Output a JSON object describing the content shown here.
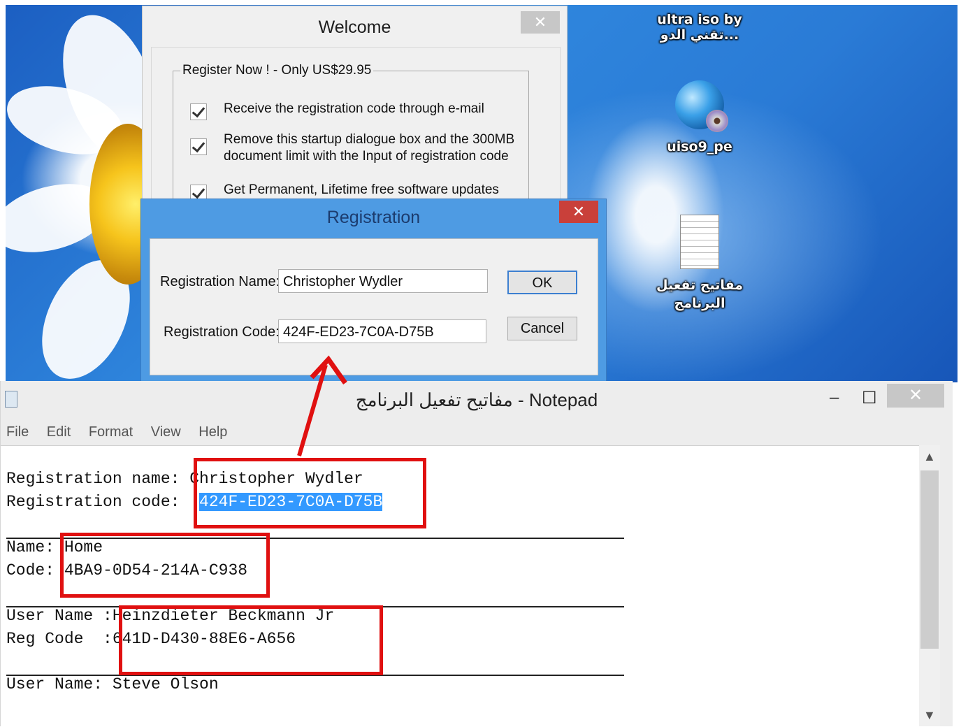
{
  "desktop": {
    "icons": [
      {
        "label": "ultra iso by تقني الدو...",
        "icon": "ultraiso-app-icon"
      },
      {
        "label": "uiso9_pe",
        "icon": "globe-disc-icon"
      },
      {
        "label": "مفاتيح تفعيل البرنامج",
        "icon": "text-file-icon"
      }
    ]
  },
  "welcome": {
    "title": "Welcome",
    "close": "✕",
    "group_label": "Register Now ! - Only US$29.95",
    "items": [
      "Receive the registration code through e-mail",
      "Remove this startup dialogue box and the 300MB document limit with the Input of registration code",
      "Get Permanent, Lifetime free software updates"
    ]
  },
  "registration": {
    "title": "Registration",
    "close": "✕",
    "name_label": "Registration Name:",
    "name_value": "Christopher Wydler",
    "code_label": "Registration Code:",
    "code_value": "424F-ED23-7C0A-D75B",
    "ok": "OK",
    "cancel": "Cancel"
  },
  "notepad": {
    "title": "مفاتيح تفعيل البرنامج - Notepad",
    "minimize": "–",
    "maximize": "☐",
    "close": "✕",
    "menu": [
      "File",
      "Edit",
      "Format",
      "View",
      "Help"
    ],
    "entries": {
      "reg_name_label": "Registration name: ",
      "reg_name_value": "Christopher Wydler",
      "reg_code_label": "Registration code:  ",
      "reg_code_value": "424F-ED23-7C0A-D75B",
      "name_label": "Name: ",
      "name_value": "Home",
      "code_label": "Code: ",
      "code_value": "4BA9-0D54-214A-C938",
      "user_label": "User Name :",
      "user_value": "Heinzdieter Beckmann Jr",
      "regcode_label": "Reg Code  :",
      "regcode_value": "641D-D430-88E6-A656",
      "user2_label": "User Name: ",
      "user2_value": "Steve Olson"
    }
  },
  "colors": {
    "annotation": "#e01010",
    "selection": "#3399ff"
  }
}
